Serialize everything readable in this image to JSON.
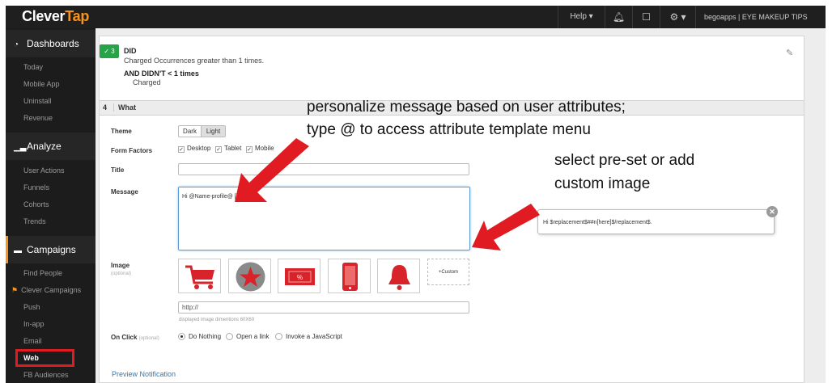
{
  "topbar": {
    "logo_part1": "Clever",
    "logo_part2": "Tap",
    "help_label": "Help ▾",
    "account_label": "begoapps | EYE MAKEUP TIPS",
    "more_label": "•••"
  },
  "sidebar": {
    "dashboards": {
      "label": "Dashboards",
      "items": [
        "Today",
        "Mobile App",
        "Uninstall",
        "Revenue"
      ]
    },
    "analyze": {
      "label": "Analyze",
      "items": [
        "User Actions",
        "Funnels",
        "Cohorts",
        "Trends"
      ]
    },
    "campaigns": {
      "label": "Campaigns",
      "items": [
        "Find People",
        "Clever Campaigns",
        "Push",
        "In-app",
        "Email",
        "Web",
        "FB Audiences"
      ]
    }
  },
  "did_block": {
    "badge": "3",
    "title": "DID",
    "description": "Charged Occurrences greater than 1 times.",
    "didnt_title": "AND DIDN'T < 1 times",
    "didnt_event": "Charged"
  },
  "what_section": {
    "number": "4",
    "label": "What"
  },
  "form": {
    "theme_label": "Theme",
    "theme_options": [
      "Dark",
      "Light"
    ],
    "form_factors_label": "Form Factors",
    "form_factors": [
      "Desktop",
      "Tablet",
      "Mobile"
    ],
    "title_label": "Title",
    "title_value": "",
    "message_label": "Message",
    "message_value": "Hi @Name-profile@ [          here          ].",
    "image_label": "Image",
    "image_sublabel": "(optional)",
    "custom_label": "+Custom",
    "image_url_value": "http://",
    "image_hint": "displayed image dimentions 60X60",
    "onclick_label": "On Click",
    "onclick_sublabel": "(optional)",
    "onclick_options": [
      "Do Nothing",
      "Open a link",
      "Invoke a JavaScript"
    ],
    "onclick_selected": "Do Nothing",
    "preview_link": "Preview Notification"
  },
  "tooltip": {
    "text": "Hi $replacement$##n[here]$/replacement$."
  },
  "annotations": {
    "line1": "personalize message based on user attributes;",
    "line2": "type @ to access attribute template menu",
    "line3": "select pre-set or add",
    "line4": "custom image"
  },
  "colors": {
    "accent": "#f7941d",
    "did_badge": "#27a348",
    "arrow_red": "#e01b22",
    "link": "#2a7ab8"
  }
}
